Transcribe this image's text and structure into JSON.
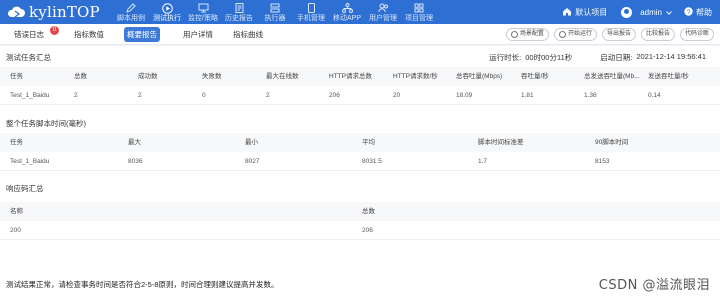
{
  "app": {
    "title": "kylinTOP"
  },
  "nav": [
    {
      "label": "脚本用例",
      "icon": "pen-icon"
    },
    {
      "label": "测试执行",
      "icon": "play-circle-icon",
      "active": true
    },
    {
      "label": "监控/策略",
      "icon": "monitor-icon"
    },
    {
      "label": "历史报告",
      "icon": "document-icon"
    },
    {
      "label": "执行器",
      "icon": "server-icon"
    },
    {
      "label": "手机管理",
      "icon": "phone-icon"
    },
    {
      "label": "移动APP",
      "icon": "network-icon"
    },
    {
      "label": "用户管理",
      "icon": "users-icon"
    },
    {
      "label": "项目管理",
      "icon": "grid-icon"
    }
  ],
  "top_right": {
    "project": "默认项目",
    "user": "admin",
    "help": "帮助"
  },
  "tabs": [
    {
      "label": "错误日志",
      "badge": "0"
    },
    {
      "label": "指标数值"
    },
    {
      "label": "概要报告",
      "active": true
    },
    {
      "label": "用户详情"
    },
    {
      "label": "指标曲线"
    }
  ],
  "tools": [
    "场景配置",
    "开始运行",
    "导出报告",
    "比较报告",
    "代码诊断"
  ],
  "summary": {
    "title": "测试任务汇总",
    "run_time_label": "运行时长:",
    "run_time": "00时00分11秒",
    "start_label": "启动日期:",
    "start": "2021-12-14 19:56:41",
    "headers": [
      "任务",
      "总数",
      "成功数",
      "失败数",
      "最大在线数",
      "HTTP请求总数",
      "HTTP请求数/秒",
      "总吞吐量(Mbps)",
      "吞吐量/秒",
      "总发送吞吐量(Mb...",
      "发送吞吐量/秒"
    ],
    "rows": [
      [
        "Test_1_Baidu",
        "2",
        "2",
        "0",
        "2",
        "206",
        "20",
        "18.09",
        "1.81",
        "1.36",
        "0.14"
      ]
    ]
  },
  "timing": {
    "title": "整个任务脚本时间(毫秒)",
    "headers": [
      "任务",
      "最大",
      "最小",
      "平均",
      "脚本时间标准差",
      "90脚本时间"
    ],
    "rows": [
      [
        "Test_1_Baidu",
        "8036",
        "8027",
        "8031.5",
        "1.7",
        "8153"
      ]
    ]
  },
  "codes": {
    "title": "响应码汇总",
    "headers": [
      "名称",
      "总数"
    ],
    "rows": [
      [
        "200",
        "206"
      ]
    ]
  },
  "footer": "测试结果正常，请检查事务时间是否符合2-5-8原则，时间合理则建议提高并发数。",
  "watermark": "CSDN @溢流眼泪",
  "colors": {
    "topbar": "#2e6fd3",
    "active_tab": "#3d79d8",
    "badge": "#e24a4a"
  }
}
